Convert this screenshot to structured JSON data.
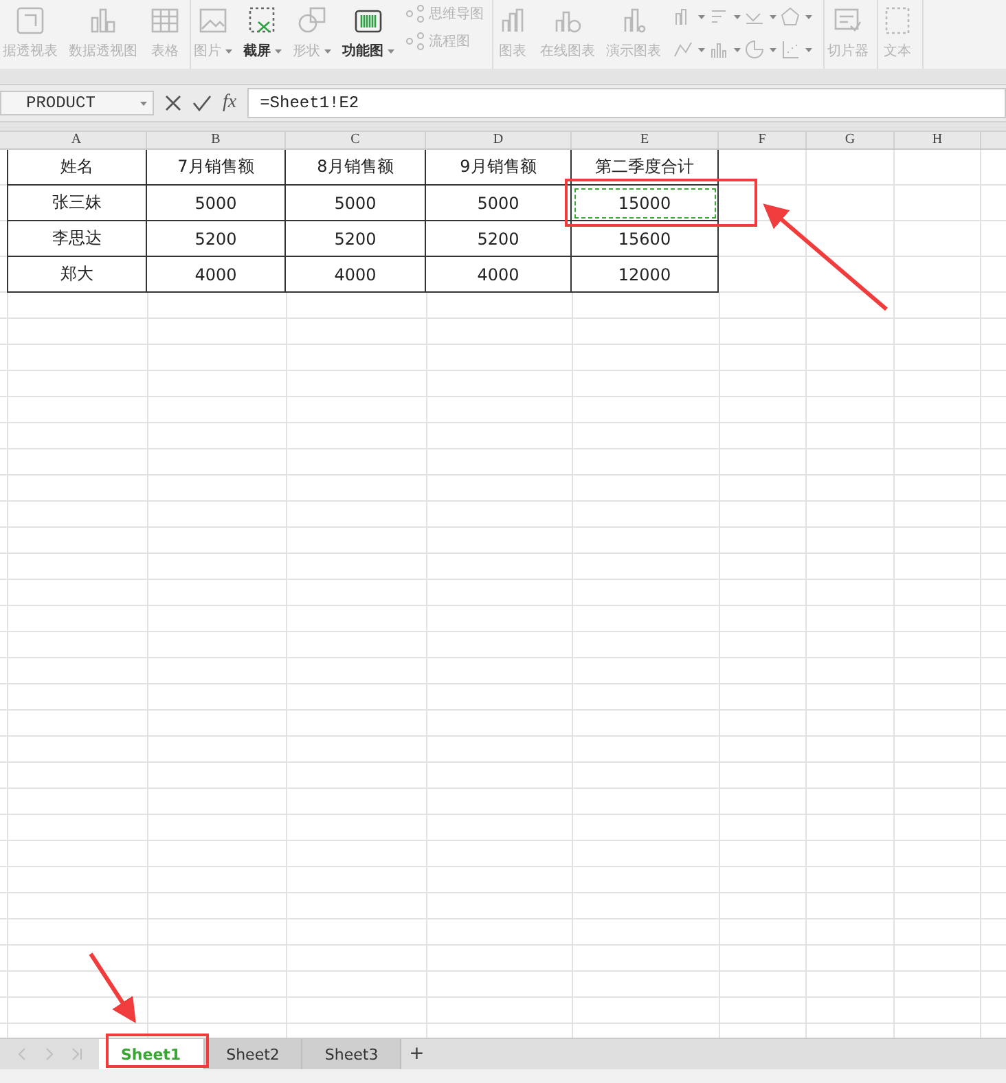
{
  "ribbon": {
    "groups": [
      {
        "items": [
          {
            "kind": "large",
            "label": "据透视表",
            "disabled": true,
            "dropdown": false
          },
          {
            "kind": "large",
            "label": "数据透视图",
            "disabled": true,
            "dropdown": false
          },
          {
            "kind": "large",
            "label": "表格",
            "disabled": true,
            "dropdown": false
          }
        ]
      },
      {
        "items": [
          {
            "kind": "large",
            "label": "图片",
            "disabled": true,
            "dropdown": true
          },
          {
            "kind": "large",
            "label": "截屏",
            "disabled": false,
            "dropdown": true
          },
          {
            "kind": "large",
            "label": "形状",
            "disabled": true,
            "dropdown": true
          },
          {
            "kind": "large",
            "label": "功能图",
            "disabled": false,
            "dropdown": true
          },
          {
            "kind": "stack",
            "disabled": true,
            "entries": [
              "思维导图",
              "流程图"
            ]
          }
        ]
      },
      {
        "items": [
          {
            "kind": "large",
            "label": "图表",
            "disabled": true,
            "dropdown": false
          },
          {
            "kind": "large",
            "label": "在线图表",
            "disabled": true,
            "dropdown": false
          },
          {
            "kind": "large",
            "label": "演示图表",
            "disabled": true,
            "dropdown": false
          },
          {
            "kind": "chart_grid",
            "disabled": true
          }
        ]
      },
      {
        "items": [
          {
            "kind": "large",
            "label": "切片器",
            "disabled": true,
            "dropdown": false
          }
        ]
      },
      {
        "items": [
          {
            "kind": "large",
            "label": "文本",
            "disabled": true,
            "dropdown": false
          }
        ]
      }
    ]
  },
  "formula_bar": {
    "name_box": "PRODUCT",
    "fx": "fx",
    "formula": "=Sheet1!E2"
  },
  "columns": [
    "A",
    "B",
    "C",
    "D",
    "E",
    "F",
    "G",
    "H"
  ],
  "rows": [
    {
      "cells": [
        {
          "text": "姓名",
          "copy_marked": false
        },
        {
          "text": "7月销售额",
          "copy_marked": false
        },
        {
          "text": "8月销售额",
          "copy_marked": false
        },
        {
          "text": "9月销售额",
          "copy_marked": false
        },
        {
          "text": "第二季度合计",
          "copy_marked": false
        }
      ]
    },
    {
      "cells": [
        {
          "text": "张三妹",
          "copy_marked": false
        },
        {
          "text": "5000",
          "copy_marked": false
        },
        {
          "text": "5000",
          "copy_marked": false
        },
        {
          "text": "5000",
          "copy_marked": false
        },
        {
          "text": "15000",
          "copy_marked": true
        }
      ]
    },
    {
      "cells": [
        {
          "text": "李思达",
          "copy_marked": false
        },
        {
          "text": "5200",
          "copy_marked": false
        },
        {
          "text": "5200",
          "copy_marked": false
        },
        {
          "text": "5200",
          "copy_marked": false
        },
        {
          "text": "15600",
          "copy_marked": false
        }
      ]
    },
    {
      "cells": [
        {
          "text": "郑大",
          "copy_marked": false
        },
        {
          "text": "4000",
          "copy_marked": false
        },
        {
          "text": "4000",
          "copy_marked": false
        },
        {
          "text": "4000",
          "copy_marked": false
        },
        {
          "text": "12000",
          "copy_marked": false
        }
      ]
    }
  ],
  "sheet_tabs": [
    {
      "label": "Sheet1",
      "selected": true
    },
    {
      "label": "Sheet2",
      "selected": false
    },
    {
      "label": "Sheet3",
      "selected": false
    }
  ],
  "add_sheet": "+"
}
